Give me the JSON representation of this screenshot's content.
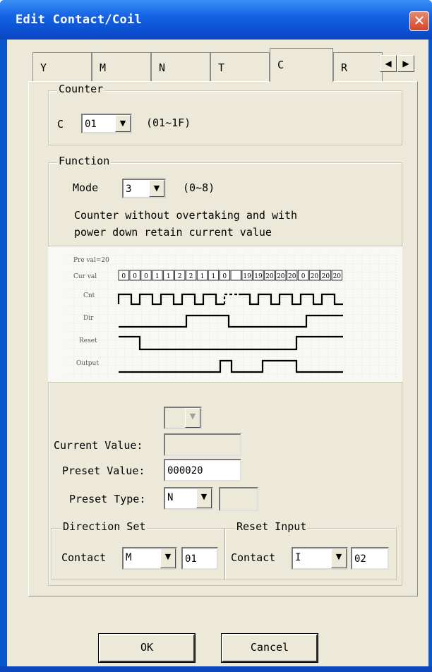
{
  "window": {
    "title": "Edit Contact/Coil"
  },
  "tabs": [
    {
      "label": "Y",
      "active": false
    },
    {
      "label": "M",
      "active": false
    },
    {
      "label": "N",
      "active": false
    },
    {
      "label": "T",
      "active": false
    },
    {
      "label": "C",
      "active": true
    },
    {
      "label": "R",
      "active": false
    }
  ],
  "tab_scroll": {
    "left_glyph": "◀",
    "right_glyph": "▶"
  },
  "counter": {
    "legend": "Counter",
    "label": "C",
    "value": "01",
    "range": "(01~1F)"
  },
  "function": {
    "legend": "Function",
    "mode_label": "Mode",
    "mode_value": "3",
    "mode_range": "(0~8)",
    "description_line1": "Counter without overtaking and with",
    "description_line2": "power down retain current value"
  },
  "timing_diagram": {
    "preset_label": "Pre val=20",
    "rows": [
      "Cur val",
      "Cnt",
      "Dir",
      "Reset",
      "Output"
    ],
    "cur_vals": [
      "0",
      "0",
      "0",
      "1",
      "1",
      "2",
      "2",
      "1",
      "1",
      "0",
      "",
      "19",
      "19",
      "20",
      "20",
      "20",
      "0",
      "20",
      "20",
      "20"
    ]
  },
  "values": {
    "aux_combo_value": "",
    "current_value_label": "Current Value:",
    "current_value": "",
    "preset_value_label": "Preset Value:",
    "preset_value": "000020",
    "preset_type_label": "Preset Type:",
    "preset_type": "N",
    "preset_type_extra": ""
  },
  "direction_set": {
    "legend": "Direction Set",
    "contact_label": "Contact",
    "contact_type": "M",
    "contact_number": "01"
  },
  "reset_input": {
    "legend": "Reset Input",
    "contact_label": "Contact",
    "contact_type": "I",
    "contact_number": "02"
  },
  "buttons": {
    "ok": "OK",
    "cancel": "Cancel"
  },
  "icons": {
    "close": "close-icon",
    "dropdown": "chevron-down-icon"
  },
  "colors": {
    "titlebar": "#0a58ce",
    "face": "#ece9d8",
    "close": "#d2442b"
  }
}
